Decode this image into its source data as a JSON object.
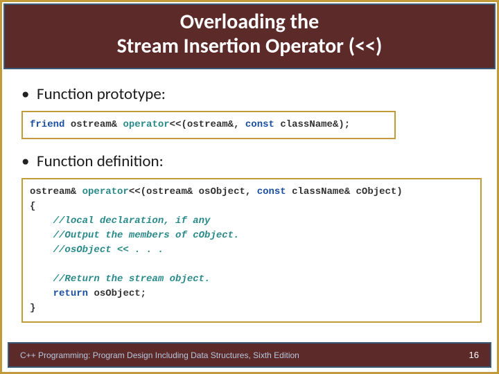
{
  "header": {
    "line1": "Overloading the",
    "line2": "Stream Insertion Operator (<<)"
  },
  "bullets": {
    "prototype": "Function prototype:",
    "definition": "Function definition:"
  },
  "code": {
    "proto": {
      "friend": "friend",
      "ostream": "ostream&",
      "operator": "operator",
      "args": "<<(ostream&,",
      "const": "const",
      "className": "className&);"
    },
    "def": {
      "ostream1": "ostream&",
      "operator": "operator",
      "sig1": "<<(ostream& osObject,",
      "const": "const",
      "sig2": "className& cObject)",
      "open": "{",
      "c1": "//local declaration, if any",
      "c2": "//Output the members of cObject.",
      "c3": "//osObject << . . .",
      "c4": "//Return the stream object.",
      "ret": "return",
      "retval": "osObject;",
      "close": "}"
    }
  },
  "footer": {
    "text": "C++ Programming: Program Design Including Data Structures, Sixth Edition",
    "page": "16"
  }
}
